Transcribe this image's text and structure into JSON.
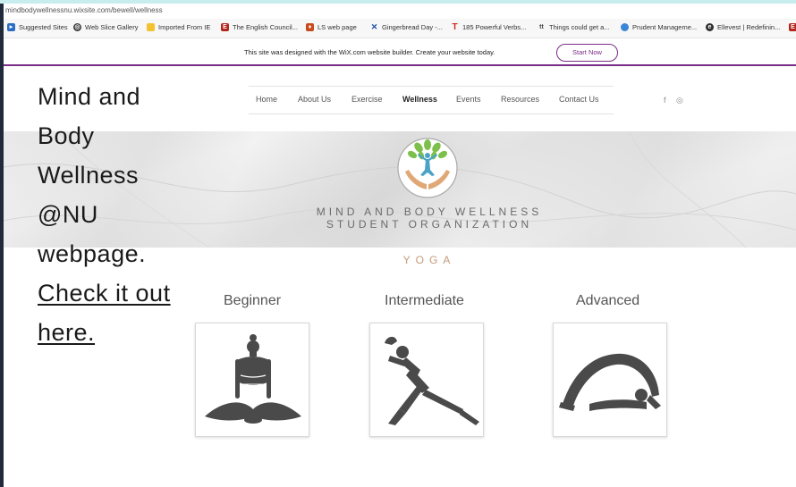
{
  "browser": {
    "url": "mindbodywellnessnu.wixsite.com/bewell/wellness",
    "bookmarks": [
      {
        "label": "Suggested Sites",
        "icon": "suggested-sites-icon",
        "color": "#2b6cc4"
      },
      {
        "label": "Web Slice Gallery",
        "icon": "web-slice-icon",
        "color": "#3b3b3b"
      },
      {
        "label": "Imported From IE",
        "icon": "folder-icon",
        "color": "#f2c230"
      },
      {
        "label": "The English Council...",
        "icon": "ec-icon",
        "color": "#b3261e"
      },
      {
        "label": "LS web page",
        "icon": "ls-icon",
        "color": "#c84b1e"
      },
      {
        "label": "Gingerbread Day -...",
        "icon": "x-icon",
        "color": "#1e4fa8"
      },
      {
        "label": "185 Powerful Verbs...",
        "icon": "t-icon",
        "color": "#d0281c"
      },
      {
        "label": "Things could get a...",
        "icon": "tt-icon",
        "color": "#444444"
      },
      {
        "label": "Prudent Manageme...",
        "icon": "globe-icon",
        "color": "#3a86d8"
      },
      {
        "label": "Ellevest | Redefinin...",
        "icon": "ellevest-icon",
        "color": "#2f2f2f"
      }
    ]
  },
  "wix_banner": {
    "message": "This site was designed with the WiX.com website builder. Create your website today.",
    "button": "Start Now"
  },
  "caption": {
    "lines": [
      "Mind and",
      "Body",
      "Wellness",
      "@NU",
      "webpage."
    ],
    "link_lines": [
      "Check it out",
      "here."
    ]
  },
  "site": {
    "nav": [
      "Home",
      "About Us",
      "Exercise",
      "Wellness",
      "Events",
      "Resources",
      "Contact Us"
    ],
    "active_nav": "Wellness",
    "social": [
      "f",
      "◎"
    ],
    "org_name_line1": "MIND AND BODY WELLNESS",
    "org_name_line2": "STUDENT ORGANIZATION",
    "section_title": "YOGA",
    "levels": [
      "Beginner",
      "Intermediate",
      "Advanced"
    ]
  },
  "colors": {
    "accent_purple": "#7a2c86",
    "yoga_title": "#c49a7a",
    "logo_leaf": "#7cc04b",
    "logo_figure": "#4aa3c7",
    "logo_hands": "#e0a877",
    "pose_fill": "#4a4a4a"
  }
}
